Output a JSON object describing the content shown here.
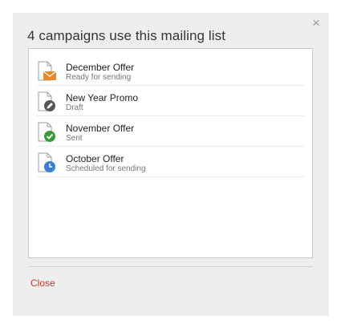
{
  "dialog": {
    "title": "4 campaigns use this mailing list",
    "close_x": "×",
    "close_label": "Close"
  },
  "campaigns": [
    {
      "name": "December Offer",
      "status": "Ready for sending",
      "icon": "document-envelope-icon",
      "badge_color": "#e8882c"
    },
    {
      "name": "New Year Promo",
      "status": "Draft",
      "icon": "document-pencil-icon",
      "badge_color": "#555555"
    },
    {
      "name": "November Offer",
      "status": "Sent",
      "icon": "document-check-icon",
      "badge_color": "#3a9a3a"
    },
    {
      "name": "October Offer",
      "status": "Scheduled for sending",
      "icon": "document-clock-icon",
      "badge_color": "#3a7fd5"
    }
  ]
}
